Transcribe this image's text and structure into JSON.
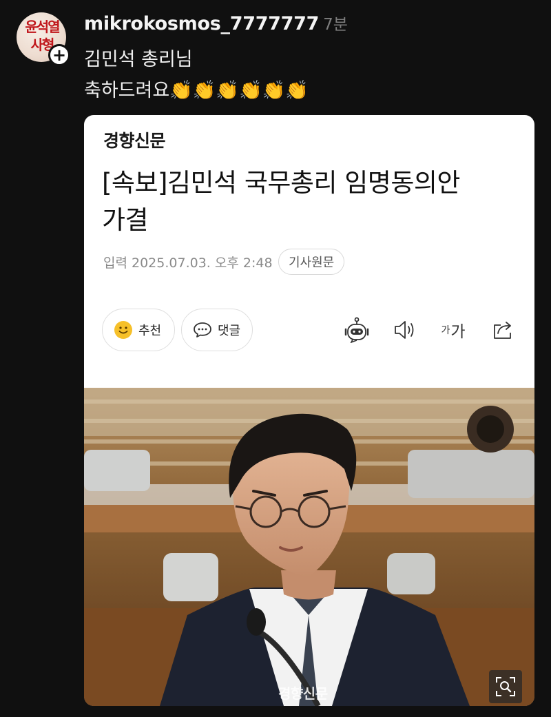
{
  "post": {
    "avatar_alt_text": "윤석열 사형",
    "username": "mikrokosmos_7777777",
    "time": "7분",
    "line1": "김민석 총리님",
    "line2": "축하드려요👏👏👏👏👏👏"
  },
  "article": {
    "press": "경향신문",
    "headline_line1": "[속보]김민석 국무총리 임명동의안",
    "headline_line2": "가결",
    "date": "입력 2025.07.03. 오후 2:48",
    "source_chip": "기사원문",
    "like_label": "추천",
    "comment_label": "댓글",
    "font_small": "가",
    "font_big": "가",
    "photo_watermark": "경향신문"
  },
  "icons": {
    "follow": "plus-icon",
    "like": "smiley-icon",
    "comment": "speech-bubble-icon",
    "bot": "robot-icon",
    "audio": "speaker-icon",
    "font": "font-size-icon",
    "share": "share-icon",
    "zoom": "zoom-icon"
  }
}
